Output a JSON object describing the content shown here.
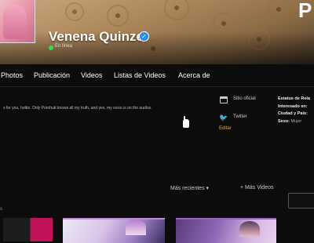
{
  "header": {
    "brand_letter": "P",
    "user_name": "Venena Quinzel",
    "status": "En línea",
    "verified_symbol": "✓",
    "colors": {
      "online": "#3dd64a",
      "verified": "#2a8ce8",
      "accent": "#f5a623"
    }
  },
  "tabs": [
    "Photos",
    "Publicación",
    "Videos",
    "Listas de Videos",
    "Acerca de"
  ],
  "bio": "s for you, hottie. Only Pornhub knows all my truth, and yes, my voice is on the audios.",
  "links": {
    "site_label": "Sitio oficial",
    "twitter_label": "Twitter",
    "twitter_icon": "twitter-bird",
    "edit_label": "Editar"
  },
  "stats": {
    "relationship_label": "Estatus de Rela",
    "interested_label": "Interesado en:",
    "location_label": "Ciudad y País:",
    "gender_label": "Sexo:",
    "gender_value": "Mujer"
  },
  "videos_section": {
    "sort_label": "Más recientes",
    "sort_caret": "▾",
    "more_label": "+ Más Videos",
    "left_marker": "s"
  }
}
